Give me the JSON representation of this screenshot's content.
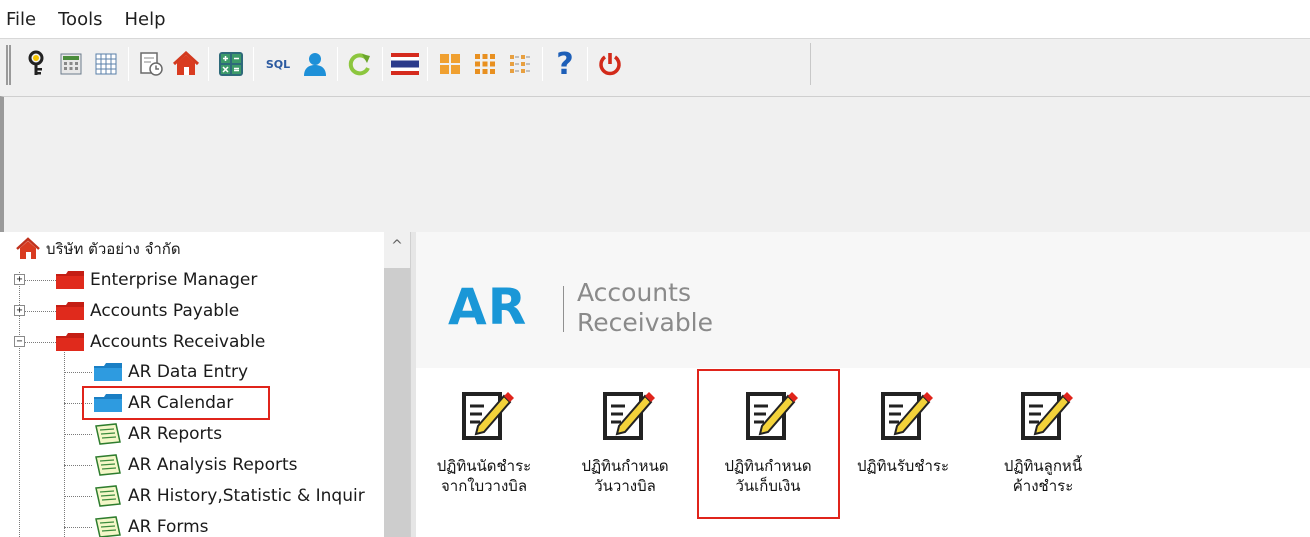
{
  "menu": [
    "File",
    "Tools",
    "Help"
  ],
  "toolbar": {
    "icons": [
      "key-icon",
      "calculator-icon",
      "grid-icon",
      "report-clock-icon",
      "home-icon",
      "calc-ops-icon",
      "sql-icon",
      "user-icon",
      "refresh-icon",
      "thai-flag-icon",
      "tile-large-icon",
      "tile-medium-icon",
      "list-view-icon",
      "help-icon",
      "power-icon"
    ],
    "sql_label": "SQL",
    "help_label": "?"
  },
  "tree": {
    "root": "บริษัท ตัวอย่าง จำกัด",
    "nodes": [
      {
        "label": "Enterprise Manager",
        "expander": "+"
      },
      {
        "label": "Accounts Payable",
        "expander": "+"
      },
      {
        "label": "Accounts Receivable",
        "expander": "−"
      }
    ],
    "children": [
      {
        "label": "AR Data Entry",
        "icon": "folder-blue-icon"
      },
      {
        "label": "AR Calendar",
        "icon": "folder-blue-icon"
      },
      {
        "label": "AR Reports",
        "icon": "report-icon"
      },
      {
        "label": "AR Analysis Reports",
        "icon": "report-icon"
      },
      {
        "label": "AR History,Statistic & Inquir",
        "icon": "report-icon"
      },
      {
        "label": "AR Forms",
        "icon": "report-icon"
      }
    ],
    "scroll_up": "^"
  },
  "header": {
    "code": "AR",
    "line1": "Accounts",
    "line2": "Receivable",
    "brand_color": "#1a97d7"
  },
  "icons": [
    {
      "l1": "ปฏิทินนัดชำระ",
      "l2": "จากใบวางบิล"
    },
    {
      "l1": "ปฏิทินกำหนด",
      "l2": "วันวางบิล"
    },
    {
      "l1": "ปฏิทินกำหนด",
      "l2": "วันเก็บเงิน"
    },
    {
      "l1": "ปฏิทินรับชำระ",
      "l2": ""
    },
    {
      "l1": "ปฏิทินลูกหนี้",
      "l2": "ค้างชำระ"
    }
  ],
  "highlight_color": "#e0241b"
}
